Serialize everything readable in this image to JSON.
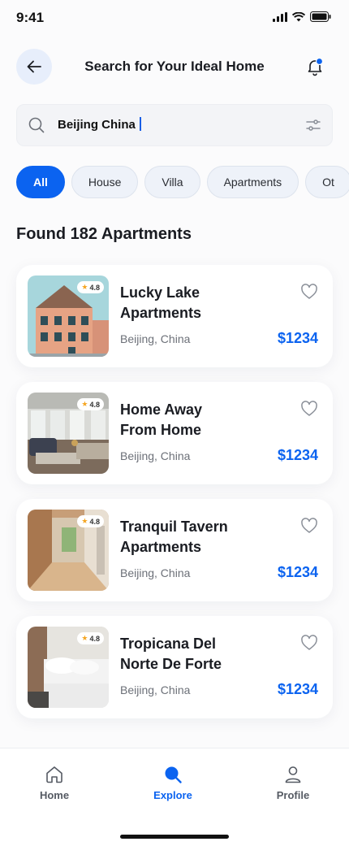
{
  "status": {
    "time": "9:41"
  },
  "header": {
    "title": "Search for Your Ideal Home"
  },
  "search": {
    "value": "Beijing China"
  },
  "chips": [
    "All",
    "House",
    "Villa",
    "Apartments",
    "Ot"
  ],
  "active_chip": "All",
  "found_label": "Found 182 Apartments",
  "listings": [
    {
      "title_line1": "Lucky Lake",
      "title_line2": "Apartments",
      "location": "Beijing, China",
      "price": "$1234",
      "rating": "4.8"
    },
    {
      "title_line1": "Home Away",
      "title_line2": "From Home",
      "location": "Beijing, China",
      "price": "$1234",
      "rating": "4.8"
    },
    {
      "title_line1": "Tranquil Tavern",
      "title_line2": "Apartments",
      "location": "Beijing, China",
      "price": "$1234",
      "rating": "4.8"
    },
    {
      "title_line1": "Tropicana Del",
      "title_line2": "Norte De Forte",
      "location": "Beijing, China",
      "price": "$1234",
      "rating": "4.8"
    }
  ],
  "nav": {
    "home": "Home",
    "explore": "Explore",
    "profile": "Profile"
  },
  "colors": {
    "accent": "#0b63f0",
    "chip_bg": "#eef2f9",
    "back_bg": "#e7eefb"
  },
  "icons": [
    "back-arrow-icon",
    "bell-icon",
    "search-icon",
    "filter-icon",
    "heart-icon",
    "star-icon",
    "home-icon",
    "explore-icon",
    "profile-icon"
  ]
}
